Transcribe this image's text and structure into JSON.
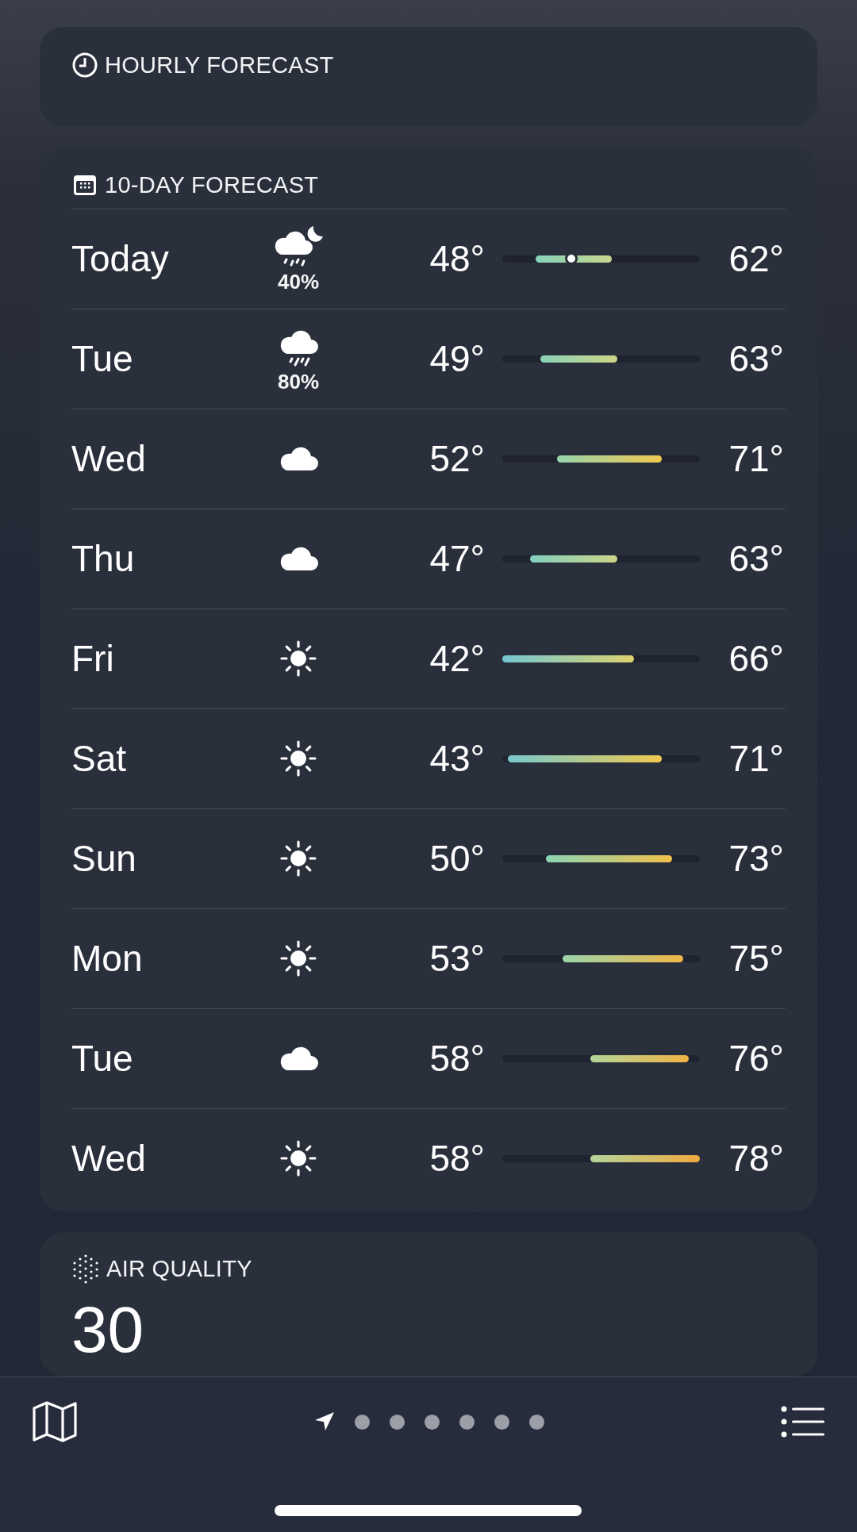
{
  "hourly_forecast": {
    "title": "HOURLY FORECAST"
  },
  "ten_day_forecast": {
    "title": "10-DAY FORECAST",
    "days": [
      {
        "day": "Today",
        "kind": "moon-rain",
        "precipitation": "40%",
        "low": "48°",
        "high": "62°",
        "marker": {
          "level": 0.35
        }
      },
      {
        "day": "Tue",
        "kind": "rain",
        "precipitation": "80%",
        "low": "49°",
        "high": "63°"
      },
      {
        "day": "Wed",
        "kind": "cloud",
        "low": "52°",
        "high": "71°"
      },
      {
        "day": "Thu",
        "kind": "cloud",
        "low": "47°",
        "high": "63°"
      },
      {
        "day": "Fri",
        "kind": "sun",
        "low": "42°",
        "high": "66°"
      },
      {
        "day": "Sat",
        "kind": "sun",
        "low": "43°",
        "high": "71°"
      },
      {
        "day": "Sun",
        "kind": "sun",
        "low": "50°",
        "high": "73°"
      },
      {
        "day": "Mon",
        "kind": "sun",
        "low": "53°",
        "high": "75°"
      },
      {
        "day": "Tue",
        "kind": "cloud",
        "low": "58°",
        "high": "76°"
      },
      {
        "day": "Wed",
        "kind": "sun",
        "low": "58°",
        "high": "78°"
      }
    ]
  },
  "air_quality": {
    "title": "AIR QUALITY",
    "value": "30"
  },
  "toolbar": {
    "pages": [
      {
        "kind": "location",
        "selected": true
      },
      {
        "kind": "dot",
        "selected": false
      },
      {
        "kind": "dot",
        "selected": false
      },
      {
        "kind": "dot",
        "selected": false
      },
      {
        "kind": "dot",
        "selected": false
      },
      {
        "kind": "dot",
        "selected": false
      },
      {
        "kind": "dot",
        "selected": false
      }
    ]
  }
}
